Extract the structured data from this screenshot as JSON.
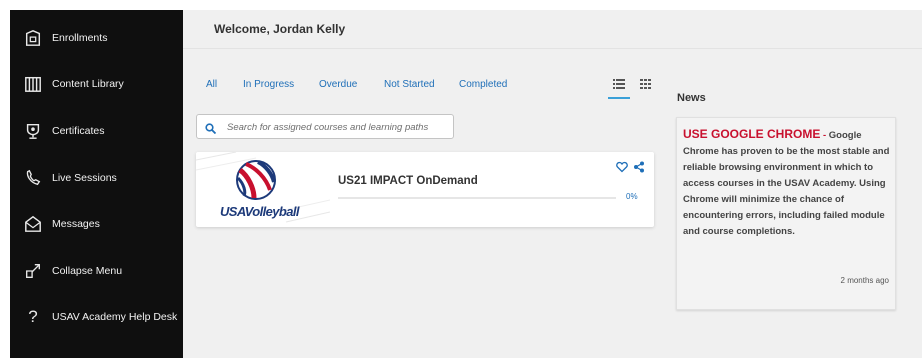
{
  "sidebar": {
    "items": [
      {
        "label": "Enrollments",
        "icon": "enrollments-icon"
      },
      {
        "label": "Content Library",
        "icon": "content-library-icon"
      },
      {
        "label": "Certificates",
        "icon": "certificates-icon"
      },
      {
        "label": "Live Sessions",
        "icon": "live-sessions-icon"
      },
      {
        "label": "Messages",
        "icon": "messages-icon"
      },
      {
        "label": "Collapse Menu",
        "icon": "collapse-icon"
      },
      {
        "label": "USAV Academy Help Desk",
        "icon": "help-icon"
      }
    ]
  },
  "header": {
    "welcome": "Welcome, Jordan Kelly"
  },
  "filters": {
    "tabs": [
      "All",
      "In Progress",
      "Overdue",
      "Not Started",
      "Completed"
    ],
    "views": [
      "list-view-icon",
      "grid-view-icon"
    ],
    "active_view": "list"
  },
  "search": {
    "placeholder": "Search for assigned courses and learning paths"
  },
  "course": {
    "title": "US21 IMPACT OnDemand",
    "progress_text": "0%",
    "progress": 0,
    "logo_text": "USAVolleyball"
  },
  "news": {
    "title": "News",
    "headline": "USE GOOGLE CHROME",
    "dash": " - ",
    "body": "Google Chrome has proven to be the most stable and reliable browsing environment in which to access courses in the USAV Academy. Using Chrome will minimize the chance of encountering errors, including failed module and course completions.",
    "time": "2 months ago"
  },
  "colors": {
    "accent": "#1f6fb8",
    "brand_red": "#c8102e",
    "sidebar_bg": "#0f0f0f"
  }
}
